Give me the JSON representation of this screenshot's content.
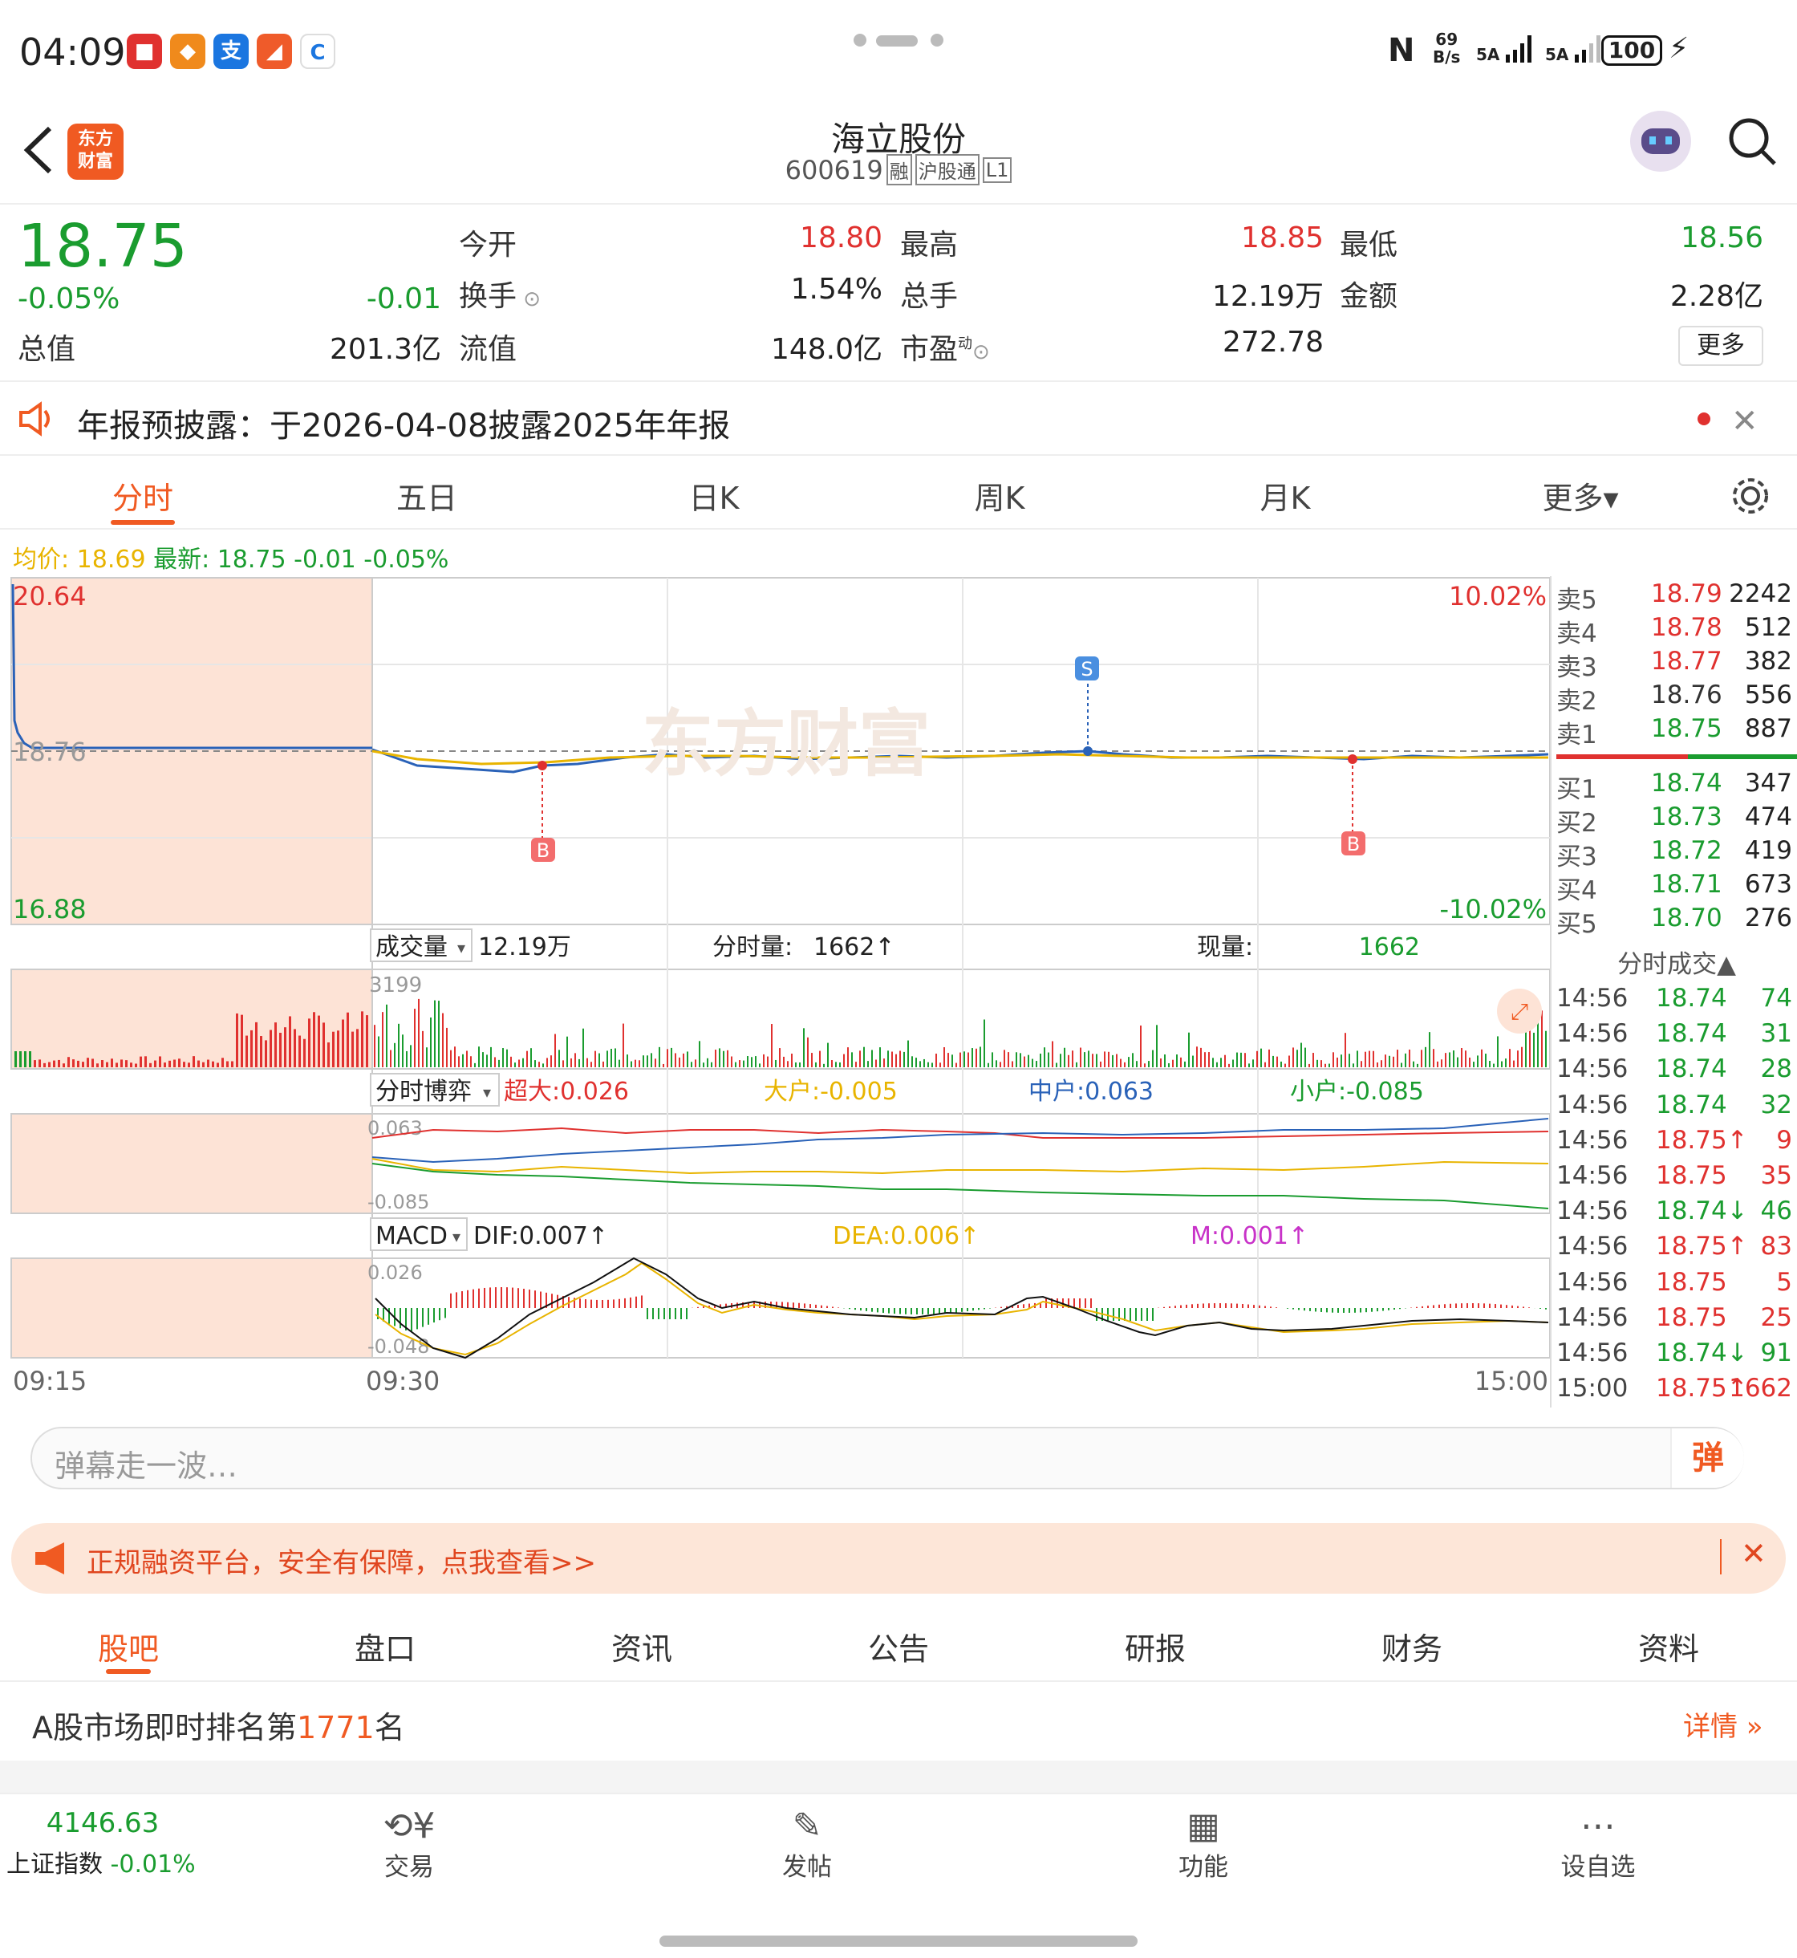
{
  "status_bar": {
    "time": "04:09",
    "net_speed_top": "69",
    "net_speed_bottom": "B/s",
    "sig1": "5A",
    "sig2": "5A",
    "battery": "100"
  },
  "header": {
    "app_logo_line1": "东方",
    "app_logo_line2": "财富",
    "stock_name": "海立股份",
    "stock_code": "600619",
    "badges": [
      "融",
      "沪股通",
      "L1"
    ]
  },
  "quote": {
    "price": "18.75",
    "change_pct": "-0.05%",
    "change_amt": "-0.01",
    "open_label": "今开",
    "open": "18.80",
    "high_label": "最高",
    "high": "18.85",
    "low_label": "最低",
    "low": "18.56",
    "turnover_label": "换手",
    "turnover": "1.54%",
    "volume_label": "总手",
    "volume": "12.19万",
    "amount_label": "金额",
    "amount": "2.28亿",
    "mcap_label": "总值",
    "mcap": "201.3亿",
    "float_label": "流值",
    "float_cap": "148.0亿",
    "pe_label": "市盈",
    "pe_sup": "动",
    "pe": "272.78",
    "more_label": "更多"
  },
  "notice": {
    "text": "年报预披露：于2026-04-08披露2025年年报"
  },
  "chart_tabs": [
    "分时",
    "五日",
    "日K",
    "周K",
    "月K",
    "更多▾"
  ],
  "chart_info": {
    "avg_label": "均价: 18.69",
    "latest_label": "最新: 18.75 -0.01 -0.05%",
    "price_max": "20.64",
    "price_min": "16.88",
    "price_ref": "18.76",
    "pct_max": "10.02%",
    "pct_min": "-10.02%",
    "marker_s": "S",
    "marker_b": "B",
    "watermark": "东方财富"
  },
  "volume_panel": {
    "selector": "成交量",
    "total": "12.19万",
    "tick_label": "分时量:",
    "tick_value": "1662↑",
    "current_label": "现量:",
    "current_value": "1662",
    "axis_max": "3199"
  },
  "flow_panel": {
    "selector": "分时博弈",
    "super_label": "超大:0.026",
    "large_label": "大户:-0.005",
    "mid_label": "中户:0.063",
    "small_label": "小户:-0.085",
    "axis_max": "0.063",
    "axis_min": "-0.085"
  },
  "macd_panel": {
    "selector": "MACD",
    "dif_label": "DIF:0.007↑",
    "dea_label": "DEA:0.006↑",
    "m_label": "M:0.001↑",
    "axis_max": "0.026",
    "axis_min": "-0.048"
  },
  "time_axis": [
    "09:15",
    "09:30",
    "15:00"
  ],
  "order_book": {
    "asks": [
      {
        "label": "卖5",
        "price": "18.79",
        "vol": "2242",
        "color": "#e0312f"
      },
      {
        "label": "卖4",
        "price": "18.78",
        "vol": "512",
        "color": "#e0312f"
      },
      {
        "label": "卖3",
        "price": "18.77",
        "vol": "382",
        "color": "#e0312f"
      },
      {
        "label": "卖2",
        "price": "18.76",
        "vol": "556",
        "color": "#333333"
      },
      {
        "label": "卖1",
        "price": "18.75",
        "vol": "887",
        "color": "#1a9c2f"
      }
    ],
    "bids": [
      {
        "label": "买1",
        "price": "18.74",
        "vol": "347",
        "color": "#1a9c2f"
      },
      {
        "label": "买2",
        "price": "18.73",
        "vol": "474",
        "color": "#1a9c2f"
      },
      {
        "label": "买3",
        "price": "18.72",
        "vol": "419",
        "color": "#1a9c2f"
      },
      {
        "label": "买4",
        "price": "18.71",
        "vol": "673",
        "color": "#1a9c2f"
      },
      {
        "label": "买5",
        "price": "18.70",
        "vol": "276",
        "color": "#1a9c2f"
      }
    ]
  },
  "trades": {
    "title": "分时成交▲",
    "rows": [
      {
        "time": "14:56",
        "price": "18.74",
        "vol": "74",
        "color": "#1a9c2f"
      },
      {
        "time": "14:56",
        "price": "18.74",
        "vol": "31",
        "color": "#1a9c2f"
      },
      {
        "time": "14:56",
        "price": "18.74",
        "vol": "28",
        "color": "#1a9c2f"
      },
      {
        "time": "14:56",
        "price": "18.74",
        "vol": "32",
        "color": "#1a9c2f"
      },
      {
        "time": "14:56",
        "price": "18.75↑",
        "vol": "9",
        "color": "#e0312f"
      },
      {
        "time": "14:56",
        "price": "18.75",
        "vol": "35",
        "color": "#e0312f"
      },
      {
        "time": "14:56",
        "price": "18.74↓",
        "vol": "46",
        "color": "#1a9c2f"
      },
      {
        "time": "14:56",
        "price": "18.75↑",
        "vol": "83",
        "color": "#e0312f"
      },
      {
        "time": "14:56",
        "price": "18.75",
        "vol": "5",
        "color": "#e0312f"
      },
      {
        "time": "14:56",
        "price": "18.75",
        "vol": "25",
        "color": "#e0312f"
      },
      {
        "time": "14:56",
        "price": "18.74↓",
        "vol": "91",
        "color": "#1a9c2f"
      },
      {
        "time": "15:00",
        "price": "18.75↑",
        "vol": "1662",
        "color": "#e0312f"
      }
    ]
  },
  "danmu": {
    "placeholder": "弹幕走一波…",
    "button": "弹"
  },
  "ad": {
    "text": "正规融资平台，安全有保障，点我查看>>"
  },
  "nav_tabs": [
    "股吧",
    "盘口",
    "资讯",
    "公告",
    "研报",
    "财务",
    "资料"
  ],
  "ranking": {
    "prefix": "A股市场即时排名第",
    "rank": "1771",
    "suffix": "名",
    "detail": "详情"
  },
  "bottom_bar": {
    "index_value": "4146.63",
    "index_name": "上证指数",
    "index_change": "-0.01%",
    "items": [
      "交易",
      "发帖",
      "功能",
      "设自选"
    ]
  }
}
